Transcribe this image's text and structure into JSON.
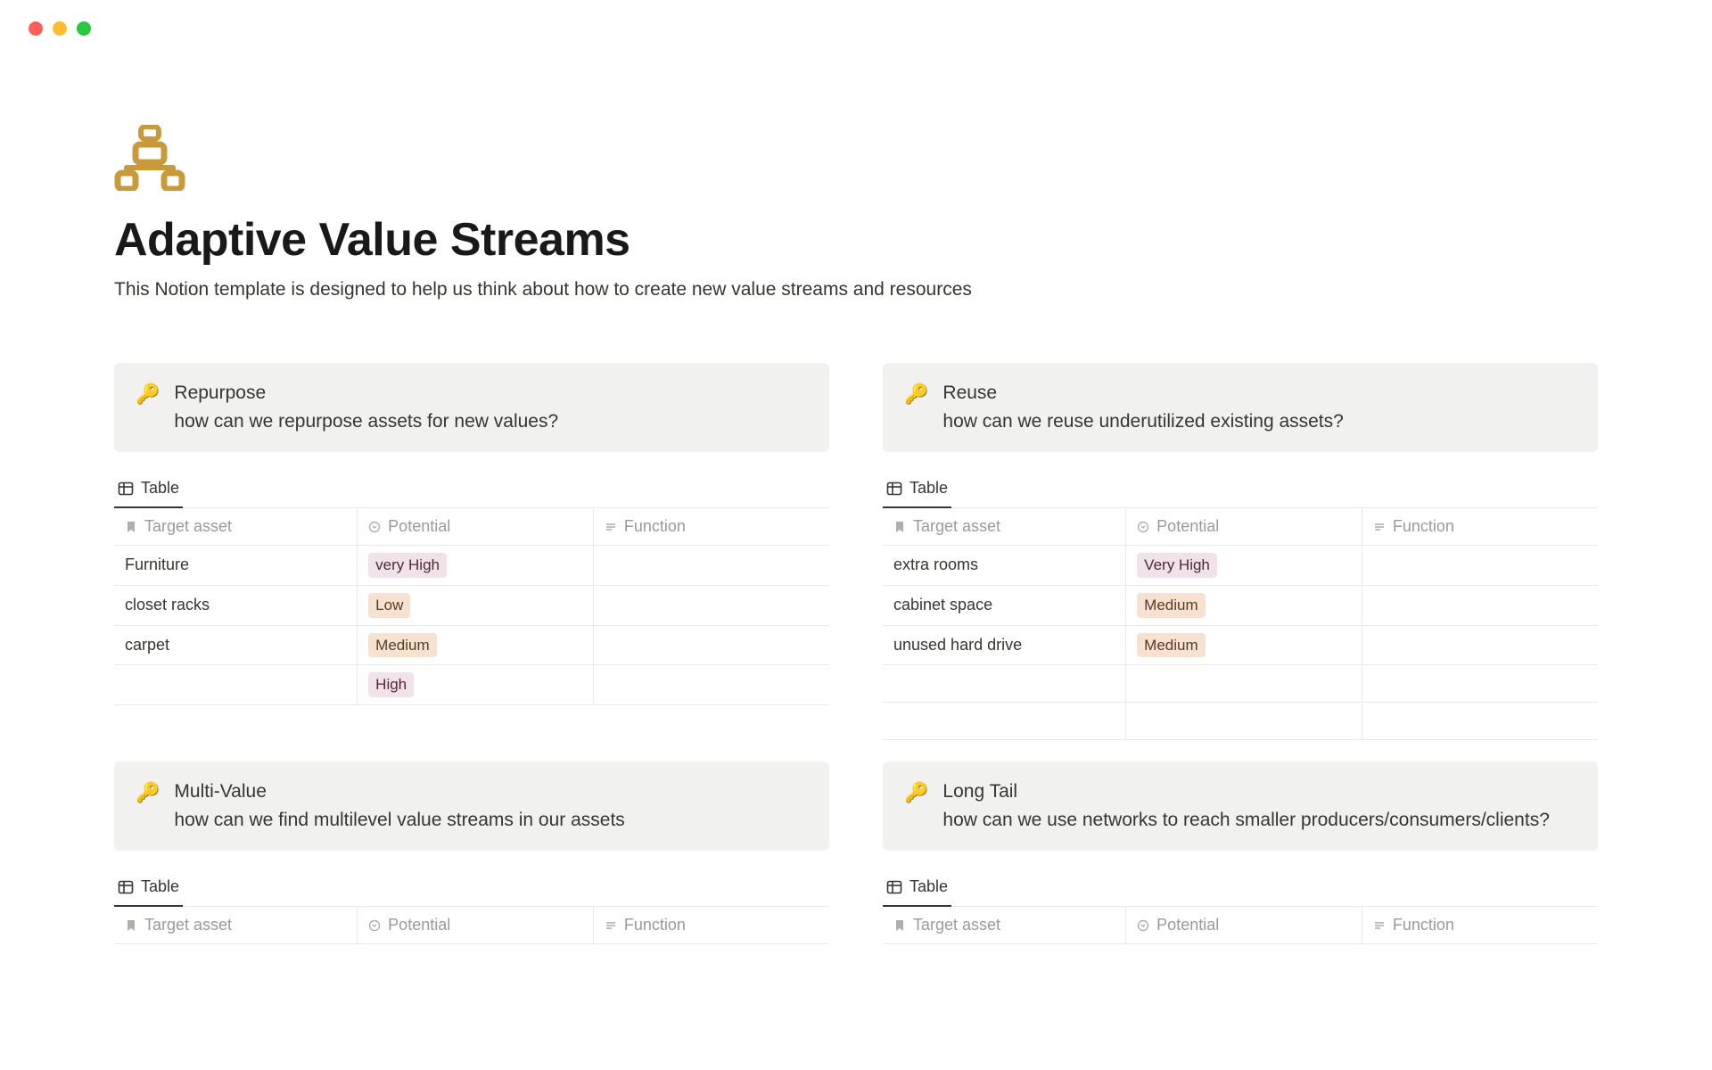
{
  "page": {
    "title": "Adaptive Value Streams",
    "subtitle": "This Notion template is designed to help us think about how to create new value streams and resources"
  },
  "view_label": "Table",
  "columns": {
    "target": "Target asset",
    "potential": "Potential",
    "function": "Function"
  },
  "sections": {
    "repurpose": {
      "title": "Repurpose",
      "question": "how can we repurpose assets for new values?",
      "rows": [
        {
          "target": "Furniture",
          "potential": "very High",
          "potential_class": "veryhigh",
          "function": ""
        },
        {
          "target": "closet racks",
          "potential": "Low",
          "potential_class": "low",
          "function": ""
        },
        {
          "target": "carpet",
          "potential": "Medium",
          "potential_class": "medium",
          "function": ""
        },
        {
          "target": "",
          "potential": "High",
          "potential_class": "high",
          "function": ""
        }
      ]
    },
    "reuse": {
      "title": "Reuse",
      "question": "how can we reuse underutilized existing assets?",
      "rows": [
        {
          "target": "extra rooms",
          "potential": "Very High",
          "potential_class": "veryhigh",
          "function": ""
        },
        {
          "target": "cabinet space",
          "potential": "Medium",
          "potential_class": "medium",
          "function": ""
        },
        {
          "target": "unused hard drive",
          "potential": "Medium",
          "potential_class": "medium",
          "function": ""
        },
        {
          "target": "",
          "potential": "",
          "potential_class": "",
          "function": ""
        },
        {
          "target": "",
          "potential": "",
          "potential_class": "",
          "function": ""
        }
      ]
    },
    "multivalue": {
      "title": "Multi-Value",
      "question": "how can we find multilevel value streams in our assets"
    },
    "longtail": {
      "title": "Long Tail",
      "question": "how can we use networks to reach smaller producers/consumers/clients?"
    }
  }
}
